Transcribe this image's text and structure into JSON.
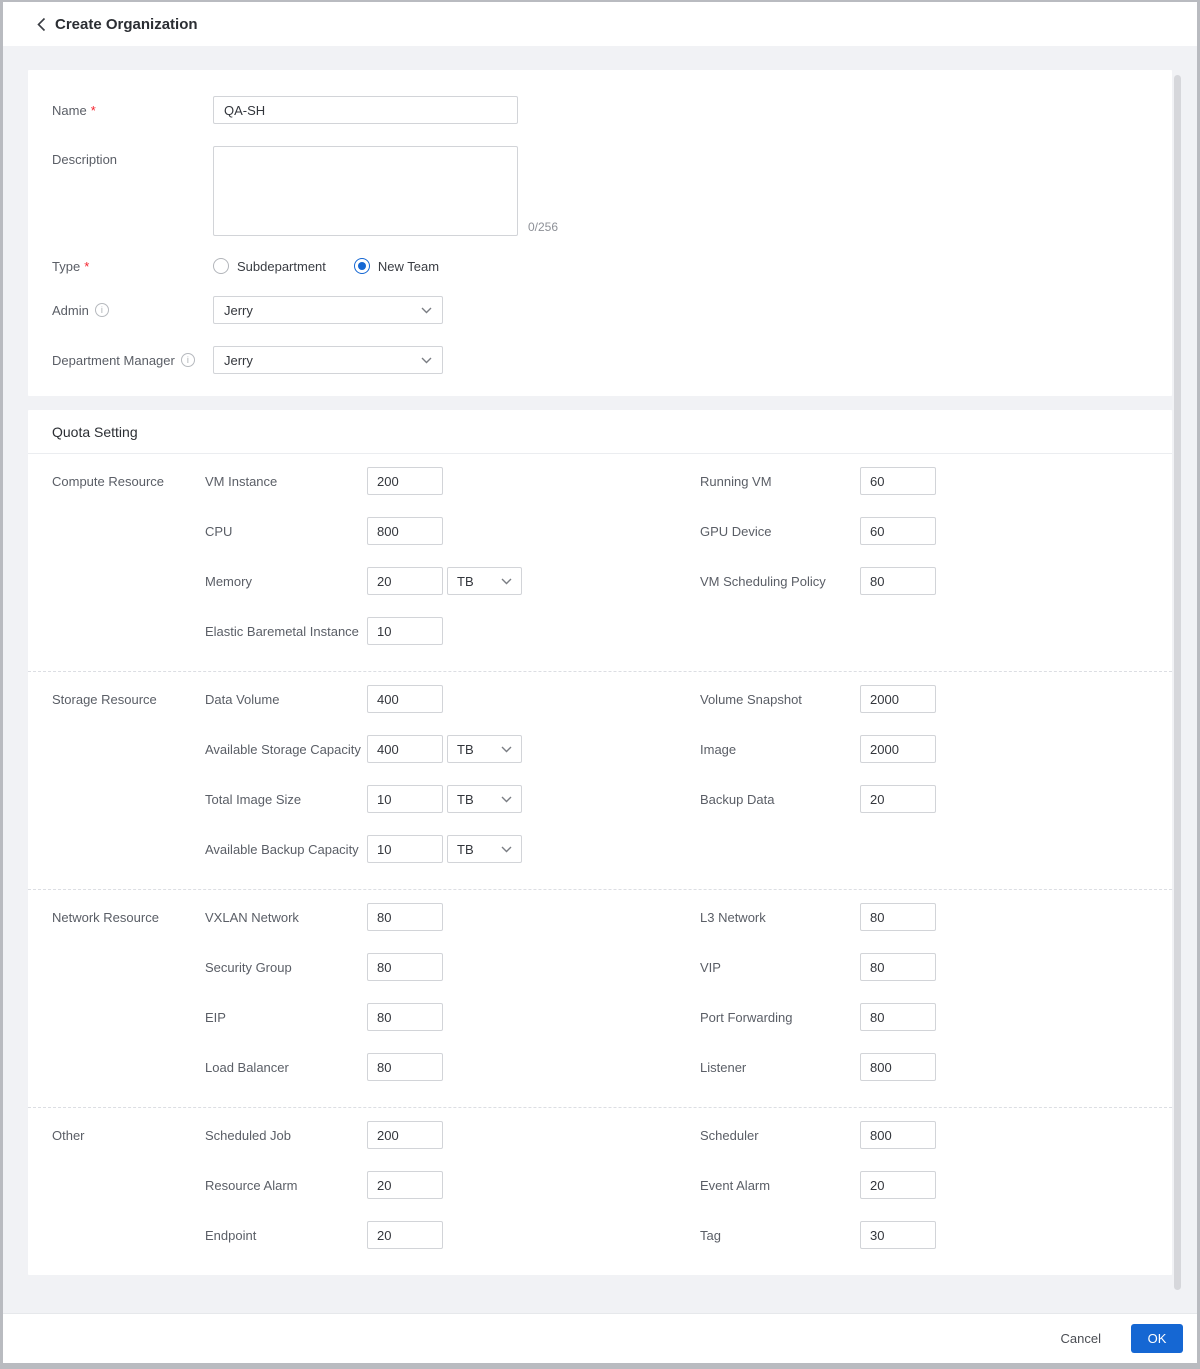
{
  "header": {
    "title": "Create Organization"
  },
  "basic": {
    "name": {
      "label": "Name",
      "value": "QA-SH"
    },
    "description": {
      "label": "Description",
      "value": "",
      "counter": "0/256"
    },
    "type": {
      "label": "Type",
      "options": [
        {
          "label": "Subdepartment",
          "selected": false
        },
        {
          "label": "New Team",
          "selected": true
        }
      ]
    },
    "admin": {
      "label": "Admin",
      "value": "Jerry"
    },
    "department_manager": {
      "label": "Department Manager",
      "value": "Jerry"
    }
  },
  "quota": {
    "title": "Quota Setting",
    "groups": [
      {
        "name": "Compute Resource",
        "left": [
          {
            "label": "VM Instance",
            "value": "200"
          },
          {
            "label": "CPU",
            "value": "800"
          },
          {
            "label": "Memory",
            "value": "20",
            "unit": "TB"
          },
          {
            "label": "Elastic Baremetal Instance",
            "value": "10"
          }
        ],
        "right": [
          {
            "label": "Running VM",
            "value": "60"
          },
          {
            "label": "GPU Device",
            "value": "60"
          },
          {
            "label": "VM Scheduling Policy",
            "value": "80"
          }
        ]
      },
      {
        "name": "Storage Resource",
        "left": [
          {
            "label": "Data Volume",
            "value": "400"
          },
          {
            "label": "Available Storage Capacity",
            "value": "400",
            "unit": "TB"
          },
          {
            "label": "Total Image Size",
            "value": "10",
            "unit": "TB"
          },
          {
            "label": "Available Backup Capacity",
            "value": "10",
            "unit": "TB"
          }
        ],
        "right": [
          {
            "label": "Volume Snapshot",
            "value": "2000"
          },
          {
            "label": "Image",
            "value": "2000"
          },
          {
            "label": "Backup Data",
            "value": "20"
          }
        ]
      },
      {
        "name": "Network Resource",
        "left": [
          {
            "label": "VXLAN Network",
            "value": "80"
          },
          {
            "label": "Security Group",
            "value": "80"
          },
          {
            "label": "EIP",
            "value": "80"
          },
          {
            "label": "Load Balancer",
            "value": "80"
          }
        ],
        "right": [
          {
            "label": "L3 Network",
            "value": "80"
          },
          {
            "label": "VIP",
            "value": "80"
          },
          {
            "label": "Port Forwarding",
            "value": "80"
          },
          {
            "label": "Listener",
            "value": "800"
          }
        ]
      },
      {
        "name": "Other",
        "left": [
          {
            "label": "Scheduled Job",
            "value": "200"
          },
          {
            "label": "Resource Alarm",
            "value": "20"
          },
          {
            "label": "Endpoint",
            "value": "20"
          }
        ],
        "right": [
          {
            "label": "Scheduler",
            "value": "800"
          },
          {
            "label": "Event Alarm",
            "value": "20"
          },
          {
            "label": "Tag",
            "value": "30"
          }
        ]
      }
    ]
  },
  "footer": {
    "cancel_label": "Cancel",
    "ok_label": "OK"
  },
  "colors": {
    "accent": "#1567d3",
    "required": "#f5222d"
  }
}
